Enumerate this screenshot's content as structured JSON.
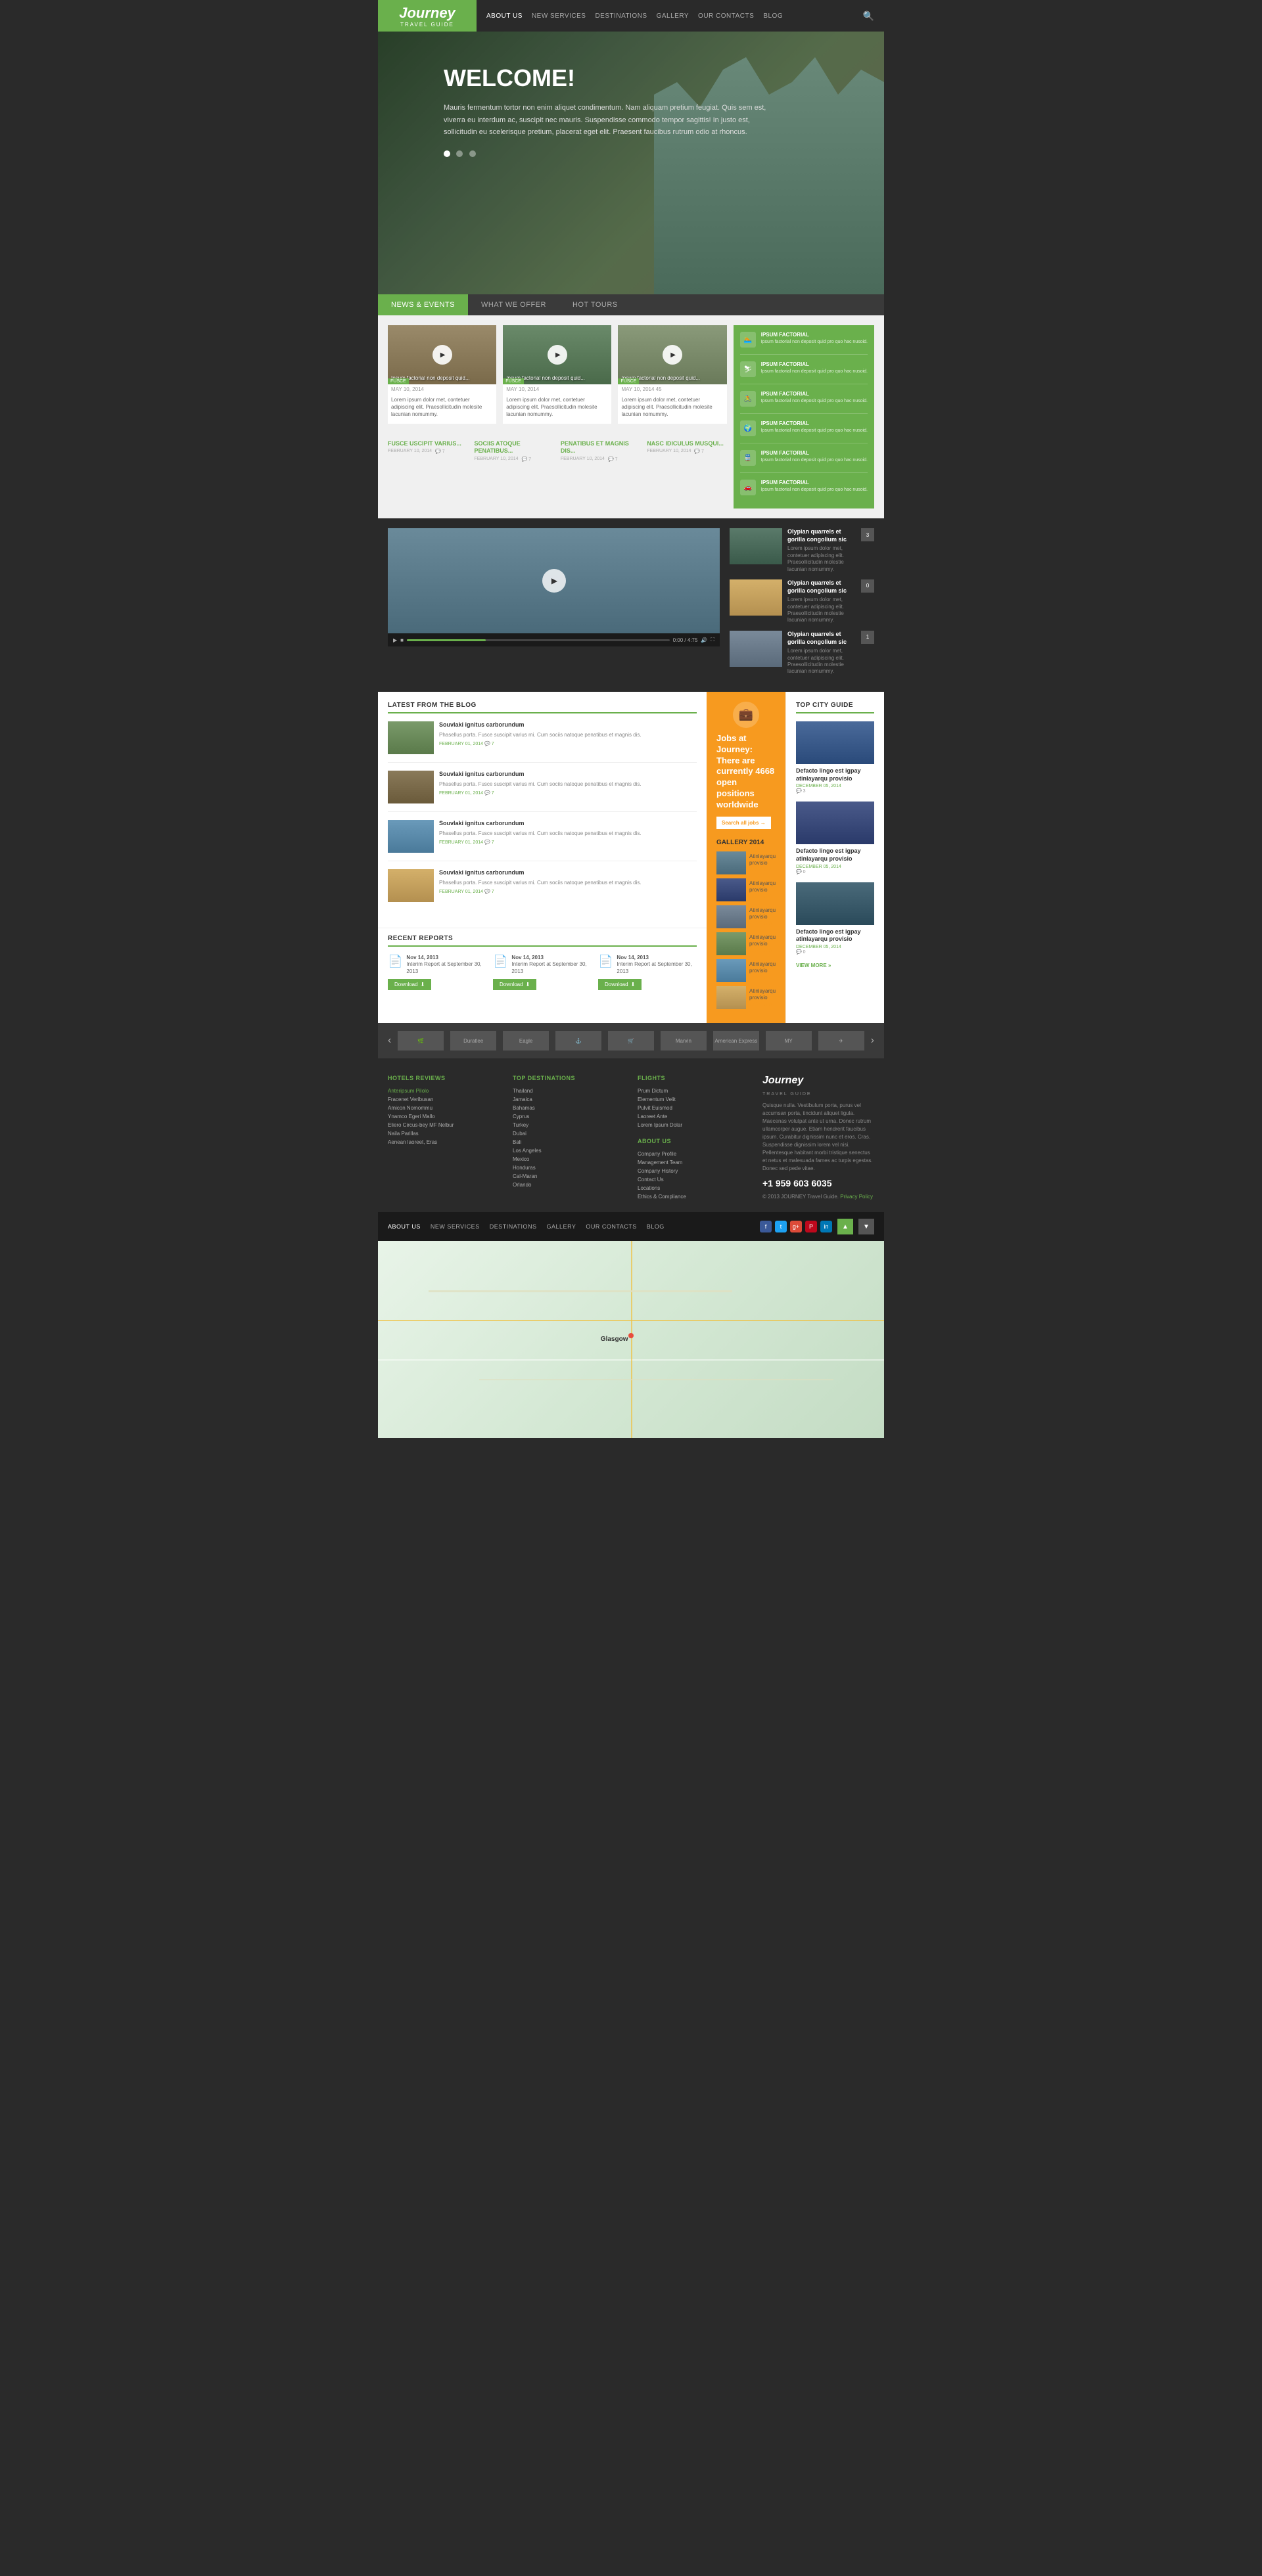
{
  "site": {
    "logo": "Journey",
    "logo_sub": "TRAVEL GUIDE",
    "tagline": "Travel Guide"
  },
  "nav": {
    "items": [
      {
        "label": "ABOUT US",
        "active": true
      },
      {
        "label": "NEW SERVICES"
      },
      {
        "label": "DESTINATIONS"
      },
      {
        "label": "GALLERY"
      },
      {
        "label": "OUR CONTACTS"
      },
      {
        "label": "BLOG"
      }
    ]
  },
  "hero": {
    "title": "WELCOME!",
    "text": "Mauris fermentum tortor non enim aliquet condimentum. Nam aliquam pretium feugiat. Quis sem est, viverra eu interdum ac, suscipit nec mauris. Suspendisse commodo tempor sagittis! In justo est, sollicitudin eu scelerisque pretium, placerat eget elit. Praesent faucibus rutrum odio at rhoncus."
  },
  "tabs": {
    "items": [
      {
        "label": "NEWS & EVENTS",
        "active": true
      },
      {
        "label": "WHAT WE OFFER"
      },
      {
        "label": "HOT TOURS"
      }
    ]
  },
  "videos": {
    "items": [
      {
        "tag": "FUSCE",
        "date": "MAY 10, 2014",
        "label": "Ipsum factorial non deposit quid...",
        "desc": "Lorem ipsum dolor met, contetuer adipiscing elit. Praesollicitudin molesite lacunian nomummy."
      },
      {
        "tag": "FUSCE",
        "date": "MAY 10, 2014",
        "label": "Ipsum factorial non deposit quid...",
        "desc": "Lorem ipsum dolor met, contetuer adipiscing elit. Praesollicitudin molesite lacunian nomummy."
      },
      {
        "tag": "FUSCE",
        "date": "MAY 10, 2014 45",
        "label": "Ipsum factorial non deposit quid...",
        "desc": "Lorem ipsum dolor met, contetuer adipiscing elit. Praesollicitudin molesite lacunian nomummy."
      }
    ]
  },
  "sidebar_green": {
    "items": [
      {
        "title": "IPSUM FACTORIAL",
        "text": "Ipsum factorial non deposit quid pro quo hac nusoid."
      },
      {
        "title": "IPSUM FACTORIAL",
        "text": "Ipsum factorial non deposit quid pro quo hac nusoid."
      },
      {
        "title": "IPSUM FACTORIAL",
        "text": "Ipsum factorial non deposit quid pro quo hac nusoid."
      },
      {
        "title": "IPSUM FACTORIAL",
        "text": "Ipsum factorial non deposit quid pro quo hac nusoid."
      },
      {
        "title": "IPSUM FACTORIAL",
        "text": "Ipsum factorial non deposit quid pro quo hac nusoid."
      },
      {
        "title": "IPSUM FACTORIAL",
        "text": "Ipsum factorial non deposit quid pro quo hac nusoid."
      }
    ]
  },
  "bottom_links": [
    {
      "title": "FUSCE USCIPIT VARIUS...",
      "date": "FEBRUARY 10, 2014",
      "comments": "7"
    },
    {
      "title": "SOCIIS ATOQUE PENATIBUS...",
      "date": "FEBRUARY 10, 2014",
      "comments": "7"
    },
    {
      "title": "PENATIBUS ET MAGNIS DIS...",
      "date": "FEBRUARY 10, 2014",
      "comments": "7"
    },
    {
      "title": "NASC IDICULUS MUSQUI...",
      "date": "FEBRUARY 10, 2014",
      "comments": "7"
    }
  ],
  "video_feature": {
    "items": [
      {
        "title": "Olypian quarrels et gorilla congolium sic",
        "text": "Lorem ipsum dolor met, contetuer adipiscing elit. Praesollicitudin molestie lacunian nomummy.",
        "num": "3"
      },
      {
        "title": "Olypian quarrels et gorilla congolium sic",
        "text": "Lorem ipsum dolor met, contetuer adipiscing elit. Praesollicitudin molestie lacunian nomummy.",
        "num": "0"
      },
      {
        "title": "Olypian quarrels et gorilla congolium sic",
        "text": "Lorem ipsum dolor met, contetuer adipiscing elit. Praesollicitudin molestie lacunian nomummy.",
        "num": "1"
      }
    ]
  },
  "blog": {
    "section_title": "LATEST FROM THE BLOG",
    "items": [
      {
        "title": "Souvlaki ignitus carborundum",
        "text": "Phasellus porta. Fusce suscipit varius mi. Cum sociis natoque penatibus et magnis dis.",
        "date": "FEBRUARY 01, 2014",
        "comments": "7"
      },
      {
        "title": "Souvlaki ignitus carborundum",
        "text": "Phasellus porta. Fusce suscipit varius mi. Cum sociis natoque penatibus et magnis dis.",
        "date": "FEBRUARY 01, 2014",
        "comments": "7"
      },
      {
        "title": "Souvlaki ignitus carborundum",
        "text": "Phasellus porta. Fusce suscipit varius mi. Cum sociis natoque penatibus et magnis dis.",
        "date": "FEBRUARY 01, 2014",
        "comments": "7"
      },
      {
        "title": "Souvlaki ignitus carborundum",
        "text": "Phasellus porta. Fusce suscipit varius mi. Cum sociis natoque penatibus et magnis dis.",
        "date": "FEBRUARY 01, 2014",
        "comments": "7"
      }
    ]
  },
  "jobs": {
    "title": "Jobs at Journey:",
    "subtitle": "There are currently 4668 open positions worldwide",
    "btn": "Search all jobs →"
  },
  "gallery": {
    "year": "GALLERY 2014",
    "items": [
      {
        "name": "Atinlayarqu provisio"
      },
      {
        "name": "Atinlayarqu provisio"
      },
      {
        "name": "Atinlayarqu provisio"
      },
      {
        "name": "Atinlayarqu provisio"
      },
      {
        "name": "Atinlayarqu provisio"
      },
      {
        "name": "Atinlayarqu provisio"
      }
    ]
  },
  "reports": {
    "section_title": "RECENT REPORTS",
    "items": [
      {
        "date": "Nov 14, 2013",
        "title": "Interim Report at September 30, 2013",
        "btn": "Download"
      },
      {
        "date": "Nov 14, 2013",
        "title": "Interim Report at September 30, 2013",
        "btn": "Download"
      },
      {
        "date": "Nov 14, 2013",
        "title": "Interim Report at September 30, 2013",
        "btn": "Download"
      }
    ]
  },
  "top_city": {
    "section_title": "TOP CITY GUIDE",
    "items": [
      {
        "title": "Defacto lingo est igpay atinlayarqu provisio",
        "date": "DECEMBER 05, 2014",
        "comments": "3"
      },
      {
        "title": "Defacto lingo est igpay atinlayarqu provisio",
        "date": "DECEMBER 05, 2014",
        "comments": "0"
      },
      {
        "title": "Defacto lingo est igpay atinlayarqu provisio",
        "date": "DECEMBER 05, 2014",
        "comments": "0"
      }
    ],
    "view_more": "VIEW MORE »"
  },
  "sponsors": {
    "items": [
      "Sponsor 1",
      "Duratlee",
      "Eagle",
      "Sponsor 4",
      "Sponsor 5",
      "Marvin",
      "American Express",
      "MY",
      "Sponsor 9"
    ]
  },
  "footer": {
    "hotels": {
      "title": "HOTELS REVIEWS",
      "links": [
        "Anteripsum Pilolo",
        "Fracenet Veribusan",
        "Amicon Nomommu",
        "Ynamco Egeri Mallo",
        "Eliero Circus-bey MF Nelbur",
        "Naila Parillas",
        "Aenean laoreet, Eras"
      ]
    },
    "destinations": {
      "title": "TOP DESTINATIONS",
      "links": [
        "Thailand",
        "Jamaica",
        "Bahamas",
        "Cyprus",
        "Turkey",
        "Dubai",
        "Bali",
        "Los Angeles",
        "Mexico",
        "Honduras",
        "Cal-Maran",
        "Orlando"
      ]
    },
    "flights": {
      "title": "FLIGHTS",
      "links": [
        "Prum Dictum",
        "Elementum Velit",
        "Pulvit Euismod",
        "Laoreet Ante",
        "Lorem Ipsum Dolar"
      ]
    },
    "about": {
      "title": "ABOUT US",
      "links": [
        "Company Profile",
        "Management Team",
        "Company History",
        "Contact Us",
        "Locations",
        "Ethics & Compliance"
      ]
    },
    "brand": {
      "name": "Journey",
      "sub": "TRAVEL GUIDE",
      "desc": "Quisque nulla. Vestibulum porta, purus vel accumsan porta, tincidunt aliquet ligula. Maecenas volutpat ante ut urna. Donec rutrum ullamcorper augue. Etiam hendrerit faucibus ipsum. Curabitur dignissim nunc et eros. Cras. Suspendisse dignissim lorem vel nisi. Pellentesque habitant morbi tristique senectus et netus et malesuada fames ac turpis egestas. Donec sed pede vitae.",
      "phone": "+1 959 603 6035",
      "copy": "© 2013 JOURNEY Travel Guide.",
      "privacy": "Privacy Policy"
    }
  },
  "bottom_nav": {
    "items": [
      {
        "label": "ABOUT US",
        "active": true
      },
      {
        "label": "NEW SERVICES"
      },
      {
        "label": "DESTINATIONS"
      },
      {
        "label": "GALLERY"
      },
      {
        "label": "OUR CONTACTS"
      },
      {
        "label": "BLOG"
      }
    ]
  },
  "colors": {
    "green": "#6ab04c",
    "orange": "#f79a1f",
    "dark": "#2a2a2a",
    "darker": "#1a1a1a"
  }
}
